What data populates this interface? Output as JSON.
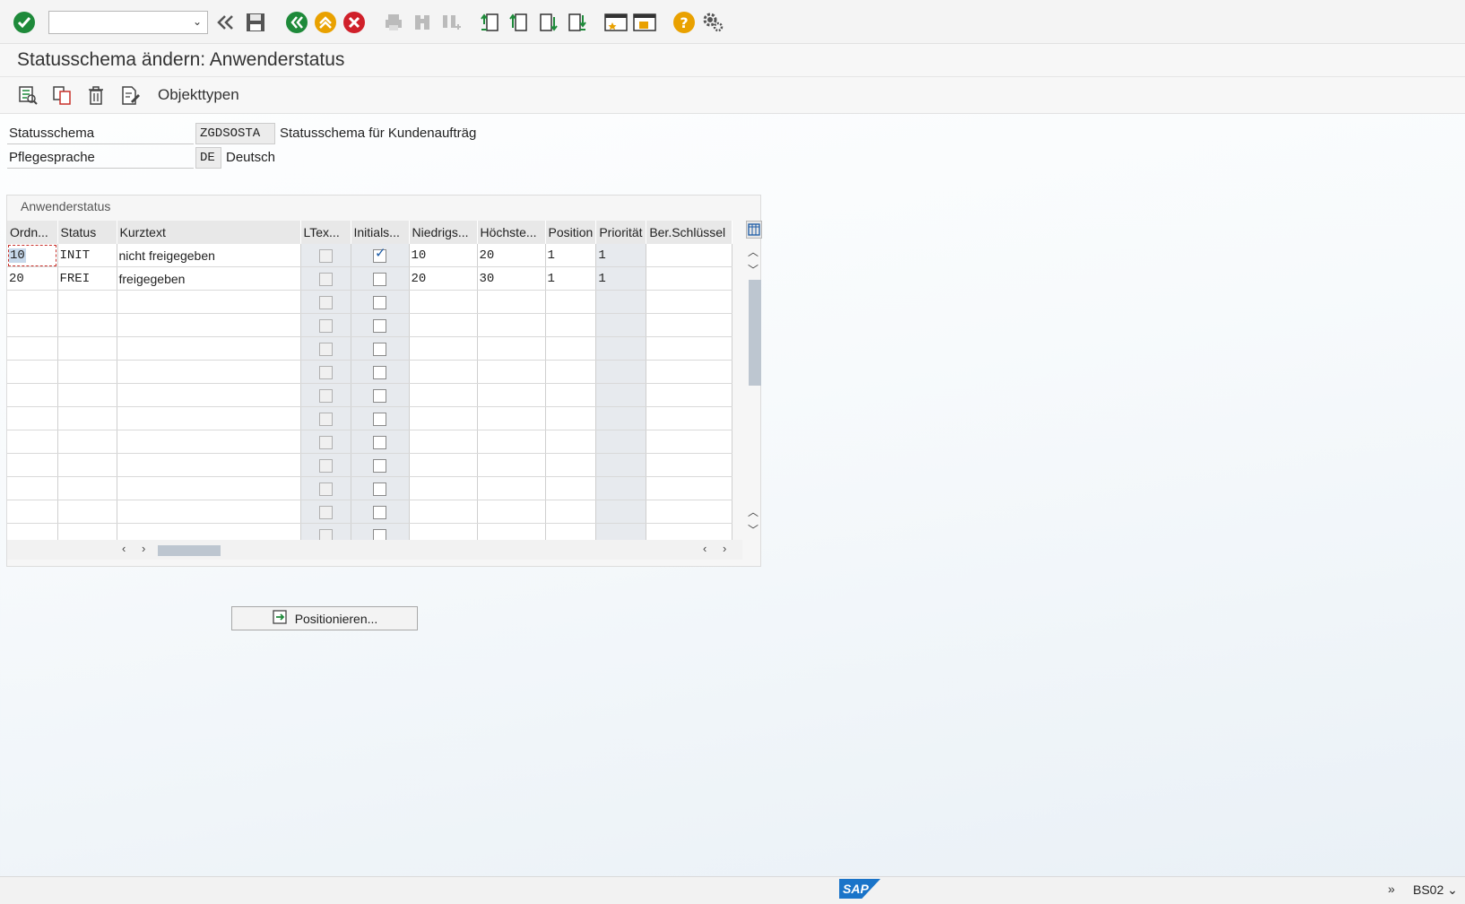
{
  "toolbar": {
    "command_field": "",
    "icons": [
      "enter-icon",
      "back-double-icon",
      "save-icon",
      "back-icon",
      "exit-icon",
      "cancel-icon",
      "print-icon",
      "find-icon",
      "find-next-icon",
      "first-page-icon",
      "previous-page-icon",
      "next-page-icon",
      "last-page-icon",
      "new-session-icon",
      "shortcut-icon",
      "help-icon",
      "settings-icon"
    ]
  },
  "title": "Statusschema ändern: Anwenderstatus",
  "app_toolbar": {
    "objekttypen_label": "Objekttypen"
  },
  "header": {
    "statusschema_label": "Statusschema",
    "statusschema_value": "ZGDSOSTA",
    "statusschema_desc": "Statusschema für Kundenaufträg",
    "sprache_label": "Pflegesprache",
    "sprache_value": "DE",
    "sprache_desc": "Deutsch"
  },
  "grid": {
    "title": "Anwenderstatus",
    "columns": [
      "Ordn...",
      "Status",
      "Kurztext",
      "LTex...",
      "Initials...",
      "Niedrigs...",
      "Höchste...",
      "Position",
      "Priorität",
      "Ber.Schlüssel"
    ],
    "rows": [
      {
        "ordn": "10",
        "status": "INIT",
        "kurztext": "nicht freigegeben",
        "ltext": false,
        "initial": true,
        "niedrig": "10",
        "hoechst": "20",
        "position": "1",
        "prioritaet": "1",
        "schluessel": ""
      },
      {
        "ordn": "20",
        "status": "FREI",
        "kurztext": "freigegeben",
        "ltext": false,
        "initial": false,
        "niedrig": "20",
        "hoechst": "30",
        "position": "1",
        "prioritaet": "1",
        "schluessel": ""
      }
    ],
    "empty_rows": 11
  },
  "positionieren_label": "Positionieren...",
  "status_bar": {
    "system": "BS02",
    "logo": "SAP"
  }
}
